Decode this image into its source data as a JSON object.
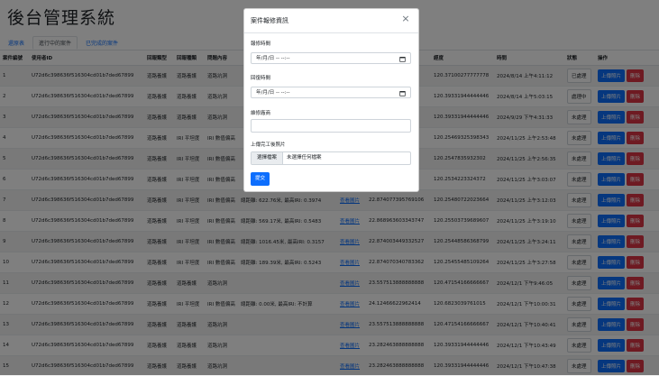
{
  "app": {
    "title": "後台管理系統"
  },
  "tabs": [
    {
      "label": "還原表"
    },
    {
      "label": "進行中的案件"
    },
    {
      "label": "已完成的案件"
    }
  ],
  "table": {
    "headers": [
      "案件編號",
      "使用者ID",
      "回報類型",
      "回報種類",
      "問題內容",
      "",
      "",
      "",
      "經度",
      "時間",
      "狀態",
      "操作"
    ],
    "rows": [
      {
        "num": "1",
        "user": "U72d6c398636f516304cd01b7ded67899",
        "type": "道路養護",
        "kind": "道路養護",
        "prob": "道路坑洞",
        "desc": "",
        "img": "",
        "lat": "35",
        "lng": "120.37100277777778",
        "time": "2024/8/14 上午4:11:12",
        "status": "已處理"
      },
      {
        "num": "2",
        "user": "U72d6c398636f516304cd01b7ded67899",
        "type": "道路養護",
        "kind": "道路養護",
        "prob": "道路坑洞",
        "desc": "",
        "img": "",
        "lat": "88",
        "lng": "120.39331944444446",
        "time": "2024/8/14 上午5:03:15",
        "status": "處理中"
      },
      {
        "num": "3",
        "user": "U72d6c398636f516304cd01b7ded67899",
        "type": "道路養護",
        "kind": "道路養護",
        "prob": "道路坑洞",
        "desc": "",
        "img": "",
        "lat": "88",
        "lng": "120.39331944444446",
        "time": "2024/9/29 下午4:31:33",
        "status": "未處理"
      },
      {
        "num": "4",
        "user": "U72d6c398636f516304cd01b7ded67899",
        "type": "道路養護",
        "kind": "IRI 平坦度",
        "prob": "IRI 數值偏高",
        "desc": "",
        "img": "",
        "lat": "45",
        "lng": "120.25469325398343",
        "time": "2024/11/25 上午2:53:48",
        "status": "未處理"
      },
      {
        "num": "5",
        "user": "U72d6c398636f516304cd01b7ded67899",
        "type": "道路養護",
        "kind": "IRI 平坦度",
        "prob": "IRI 數值偏高",
        "desc": "",
        "img": "",
        "lat": "21",
        "lng": "120.2547835932302",
        "time": "2024/11/25 上午2:56:35",
        "status": "未處理"
      },
      {
        "num": "6",
        "user": "U72d6c398636f516304cd01b7ded67899",
        "type": "道路養護",
        "kind": "IRI 平坦度",
        "prob": "IRI 數值偏高",
        "desc": "",
        "img": "",
        "lat": "47",
        "lng": "120.2534223324372",
        "time": "2024/11/25 上午3:03:07",
        "status": "未處理"
      },
      {
        "num": "7",
        "user": "U72d6c398636f516304cd01b7ded67899",
        "type": "道路養護",
        "kind": "IRI 平坦度",
        "prob": "IRI 數值偏高",
        "desc": "總距離: 622.76米, 最高IRI: 0.3974",
        "img": "查看圖片",
        "lat": "22.874077395769106",
        "lng": "120.25480722023664",
        "time": "2024/11/25 上午3:12:03",
        "status": "未處理"
      },
      {
        "num": "8",
        "user": "U72d6c398636f516304cd01b7ded67899",
        "type": "道路養護",
        "kind": "IRI 平坦度",
        "prob": "IRI 數值偏高",
        "desc": "總距離: 569.17米, 最高IRI: 0.5483",
        "img": "查看圖片",
        "lat": "22.868963603343747",
        "lng": "120.25503739689607",
        "time": "2024/11/25 上午3:19:10",
        "status": "未處理"
      },
      {
        "num": "9",
        "user": "U72d6c398636f516304cd01b7ded67899",
        "type": "道路養護",
        "kind": "IRI 平坦度",
        "prob": "IRI 數值偏高",
        "desc": "總距離: 1016.45米, 最高IRI: 0.3157",
        "img": "查看圖片",
        "lat": "22.874003449332527",
        "lng": "120.25448586368799",
        "time": "2024/11/25 上午3:24:11",
        "status": "未處理"
      },
      {
        "num": "10",
        "user": "U72d6c398636f516304cd01b7ded67899",
        "type": "道路養護",
        "kind": "IRI 平坦度",
        "prob": "IRI 數值偏高",
        "desc": "總距離: 189.39米, 最高IRI: 0.5243",
        "img": "查看圖片",
        "lat": "22.874070340783362",
        "lng": "120.25455485109264",
        "time": "2024/11/25 上午3:27:58",
        "status": "未處理"
      },
      {
        "num": "11",
        "user": "U72d6c398636f516304cd01b7ded67899",
        "type": "道路養護",
        "kind": "道路養護",
        "prob": "道路坑洞",
        "desc": "",
        "img": "查看圖片",
        "lat": "23.557513888888888",
        "lng": "120.47154166666667",
        "time": "2024/12/1 下午9:46:05",
        "status": "未處理"
      },
      {
        "num": "12",
        "user": "U72d6c398636f516304cd01b7ded67899",
        "type": "道路養護",
        "kind": "IRI 平坦度",
        "prob": "IRI 數值偏高",
        "desc": "總距離: 0.00米, 最高IRI: 不計算",
        "img": "查看圖片",
        "lat": "24.12466622962414",
        "lng": "120.6823039761015",
        "time": "2024/12/1 下午10:00:31",
        "status": "未處理"
      },
      {
        "num": "13",
        "user": "U72d6c398636f516304cd01b7ded67899",
        "type": "道路養護",
        "kind": "道路養護",
        "prob": "道路坑洞",
        "desc": "",
        "img": "查看圖片",
        "lat": "23.557513888888888",
        "lng": "120.47154166666667",
        "time": "2024/12/1 下午10:40:41",
        "status": "未處理"
      },
      {
        "num": "14",
        "user": "U72d6c398636f516304cd01b7ded67899",
        "type": "道路養護",
        "kind": "道路養護",
        "prob": "道路坑洞",
        "desc": "",
        "img": "查看圖片",
        "lat": "23.282463888888888",
        "lng": "120.39331944444446",
        "time": "2024/12/1 下午10:43:49",
        "status": "未處理"
      },
      {
        "num": "15",
        "user": "U72d6c398636f516304cd01b7ded67899",
        "type": "道路養護",
        "kind": "道路養護",
        "prob": "道路坑洞",
        "desc": "",
        "img": "查看圖片",
        "lat": "23.282463888888888",
        "lng": "120.39331944444446",
        "time": "2024/12/1 下午10:47:38",
        "status": "未處理"
      }
    ],
    "upload_label": "上傳照片",
    "delete_label": "刪除"
  },
  "modal": {
    "title": "案件報修資訊",
    "close_glyph": "×",
    "repair_time_label": "報修時間",
    "repair_time_value": "年/月/日 -- --:--",
    "return_time_label": "回復時間",
    "return_time_value": "年/月/日 -- --:--",
    "vendor_label": "維修廠商",
    "vendor_value": "",
    "upload_label": "上傳完工後照片",
    "file_button": "選擇檔案",
    "file_none": "未選擇任何檔案",
    "submit_label": "提交"
  },
  "colors": {
    "primary": "#0d6efd",
    "danger": "#dc3545"
  }
}
